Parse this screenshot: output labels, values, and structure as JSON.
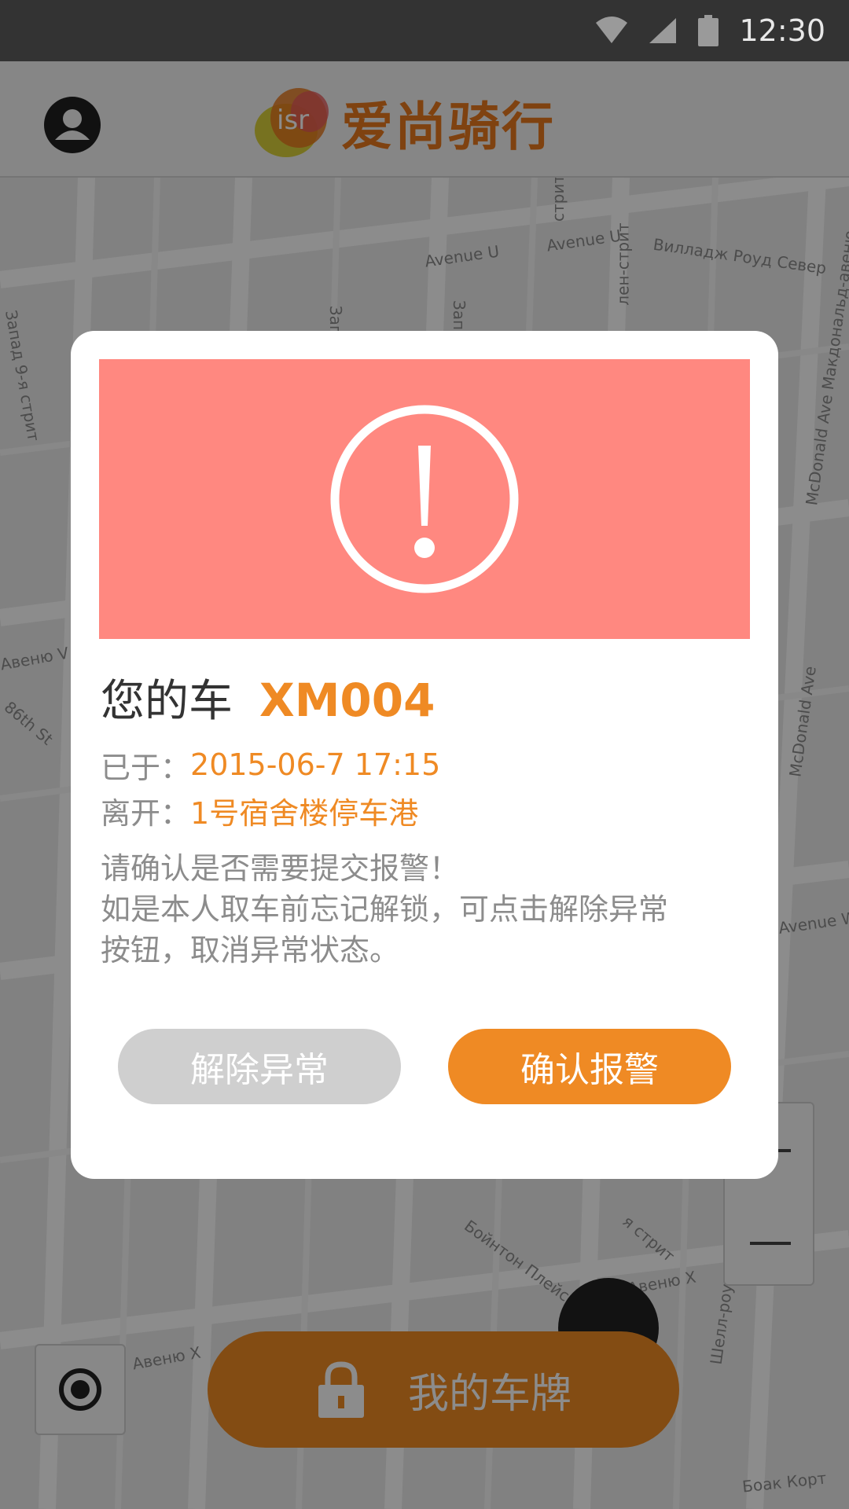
{
  "status_bar": {
    "time": "12:30",
    "icons": [
      "wifi-icon",
      "signal-icon",
      "battery-icon"
    ]
  },
  "app_bar": {
    "title": "爱尚骑行",
    "logo_text": "isr"
  },
  "map": {
    "labels": [
      "Avenue U",
      "Avenue U",
      "Вилладж Роуд Север",
      "McDonald Ave Макдональд-авеню",
      "McDonald Ave",
      "86th St",
      "Авеню V",
      "Avenue W",
      "Бойнтон Плейс",
      "Авеню X",
      "Авеню X",
      "Шелл-роуд",
      "Боак Корт",
      "стрит",
      "Запа",
      "Запад",
      "лен-стрит",
      "Запад 9-я стрит",
      "я стрит"
    ]
  },
  "plate_button": {
    "label": "我的车牌"
  },
  "dialog": {
    "vehicle_prefix": "您的车",
    "vehicle_id": "XM004",
    "time_label": "已于：",
    "time_value": "2015-06-7 17:15",
    "location_label": "离开：",
    "location_value": "1号宿舍楼停车港",
    "message_lines": [
      "请确认是否需要提交报警！",
      "如是本人取车前忘记解锁，可点击解除异常",
      "按钮，取消异常状态。"
    ],
    "dismiss_label": "解除异常",
    "confirm_label": "确认报警"
  },
  "colors": {
    "accent": "#ef8a24",
    "alert": "#ff8880",
    "muted": "#8c8c8c"
  }
}
